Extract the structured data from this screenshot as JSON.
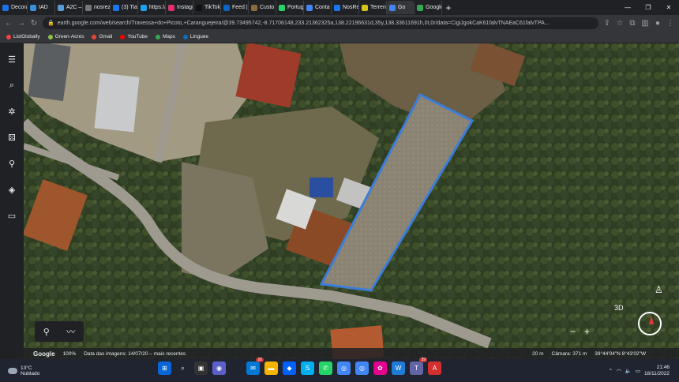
{
  "browser": {
    "tabs": [
      {
        "label": "Decora",
        "color": "#1a73e8"
      },
      {
        "label": "IAD",
        "color": "#3a8fd9"
      },
      {
        "label": "A2C – C",
        "color": "#5b9bd5"
      },
      {
        "label": "nosrezo",
        "color": "#777"
      },
      {
        "label": "(3) Tias",
        "color": "#1877f2"
      },
      {
        "label": "https://",
        "color": "#1da1f2"
      },
      {
        "label": "Instagr",
        "color": "#e1306c"
      },
      {
        "label": "TikTok",
        "color": "#111"
      },
      {
        "label": "Feed |",
        "color": "#0a66c2"
      },
      {
        "label": "Custo",
        "color": "#8b6b3d"
      },
      {
        "label": "Portug",
        "color": "#25d366"
      },
      {
        "label": "Conta",
        "color": "#4285f4"
      },
      {
        "label": "NosRe",
        "color": "#1877f2"
      },
      {
        "label": "Terren",
        "color": "#d4c21a"
      },
      {
        "label": "Go",
        "color": "#4285f4",
        "active": true
      },
      {
        "label": "Google",
        "color": "#34a853"
      }
    ],
    "new_tab": "+",
    "url": "earth.google.com/web/search/Travessa+do+Picoto,+Caranguejeira/@39.73495742,-8.71706148,233.21362325a,138.22196631d,35y,138.33611691h,0t,0r/data=CigiJgokCaK61falvTNAEaC61falvTPA...",
    "bookmarks": [
      {
        "label": "ListGlobally",
        "color": "#e44"
      },
      {
        "label": "Green-Acres",
        "color": "#8bc34a"
      },
      {
        "label": "Gmail",
        "color": "#ea4335"
      },
      {
        "label": "YouTube",
        "color": "#ff0000"
      },
      {
        "label": "Maps",
        "color": "#34a853"
      },
      {
        "label": "Linguee",
        "color": "#0b6cbd"
      }
    ]
  },
  "earth": {
    "bottom": {
      "logo": "Google",
      "zoom": "100%",
      "imagery": "Data das imagens: 14/07/20 – mais recentes",
      "scale": "20 m",
      "camera": "Câmara: 371 m",
      "coords": "39°44'04\"N 8°43'02\"W"
    },
    "compass_label": "3D",
    "plot_outline_color": "#3b7dd8"
  },
  "taskbar": {
    "temp": "13°C",
    "weather": "Nublado",
    "time": "21:46",
    "date": "18/11/2022",
    "badge1": "20",
    "badge2": "39"
  }
}
